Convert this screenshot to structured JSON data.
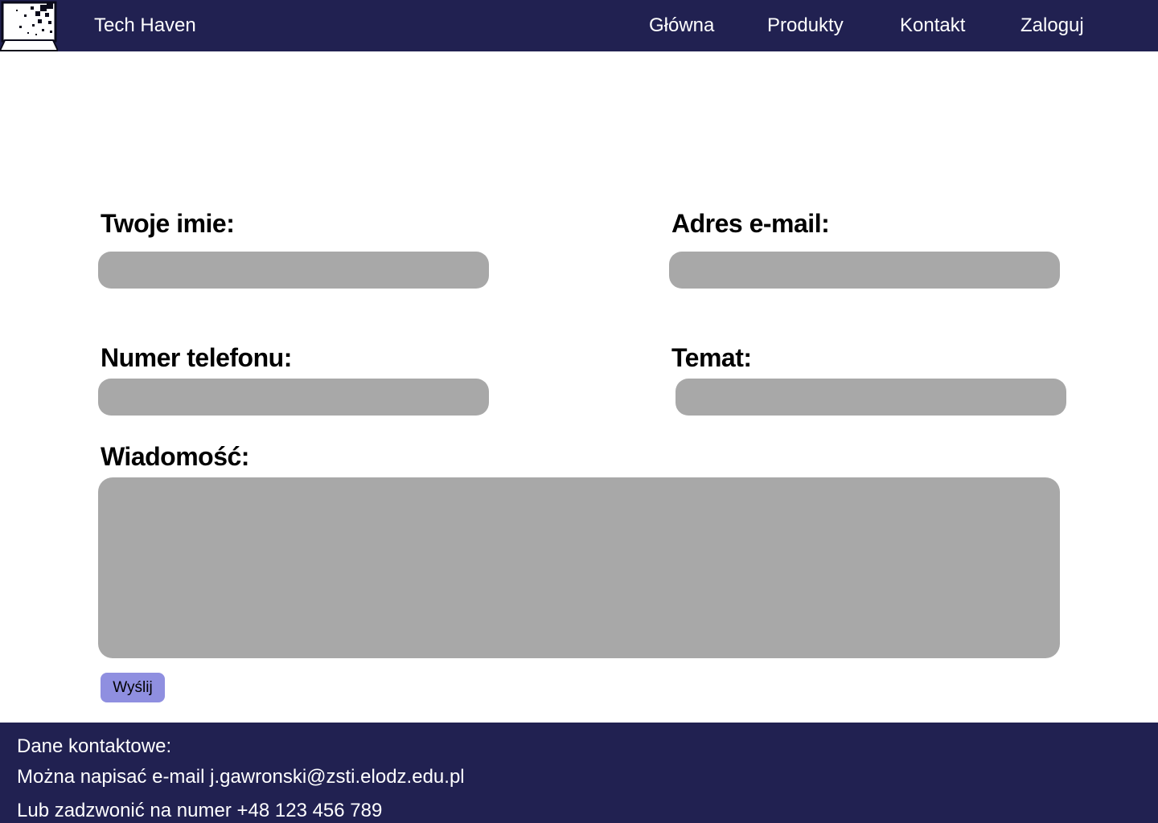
{
  "colors": {
    "navbar_bg": "#212151",
    "footer_bg": "#212151",
    "input_bg": "#a8a8a8",
    "button_bg": "#8f8fe0",
    "text_light": "#ffffff"
  },
  "header": {
    "logo_icon": "laptop-pixel-logo-icon",
    "brand": "Tech Haven",
    "nav": [
      {
        "label": "Główna"
      },
      {
        "label": "Produkty"
      },
      {
        "label": "Kontakt"
      },
      {
        "label": "Zaloguj"
      }
    ]
  },
  "form": {
    "name_label": "Twoje imie:",
    "name_value": "",
    "email_label": "Adres e-mail:",
    "email_value": "",
    "phone_label": "Numer telefonu:",
    "phone_value": "",
    "subject_label": "Temat:",
    "subject_value": "",
    "message_label": "Wiadomość:",
    "message_value": "",
    "submit_label": "Wyślij"
  },
  "footer": {
    "heading": "Dane kontaktowe:",
    "email_line": "Można napisać e-mail j.gawronski@zsti.elodz.edu.pl",
    "phone_line": "Lub zadzwonić na numer +48 123 456 789"
  }
}
